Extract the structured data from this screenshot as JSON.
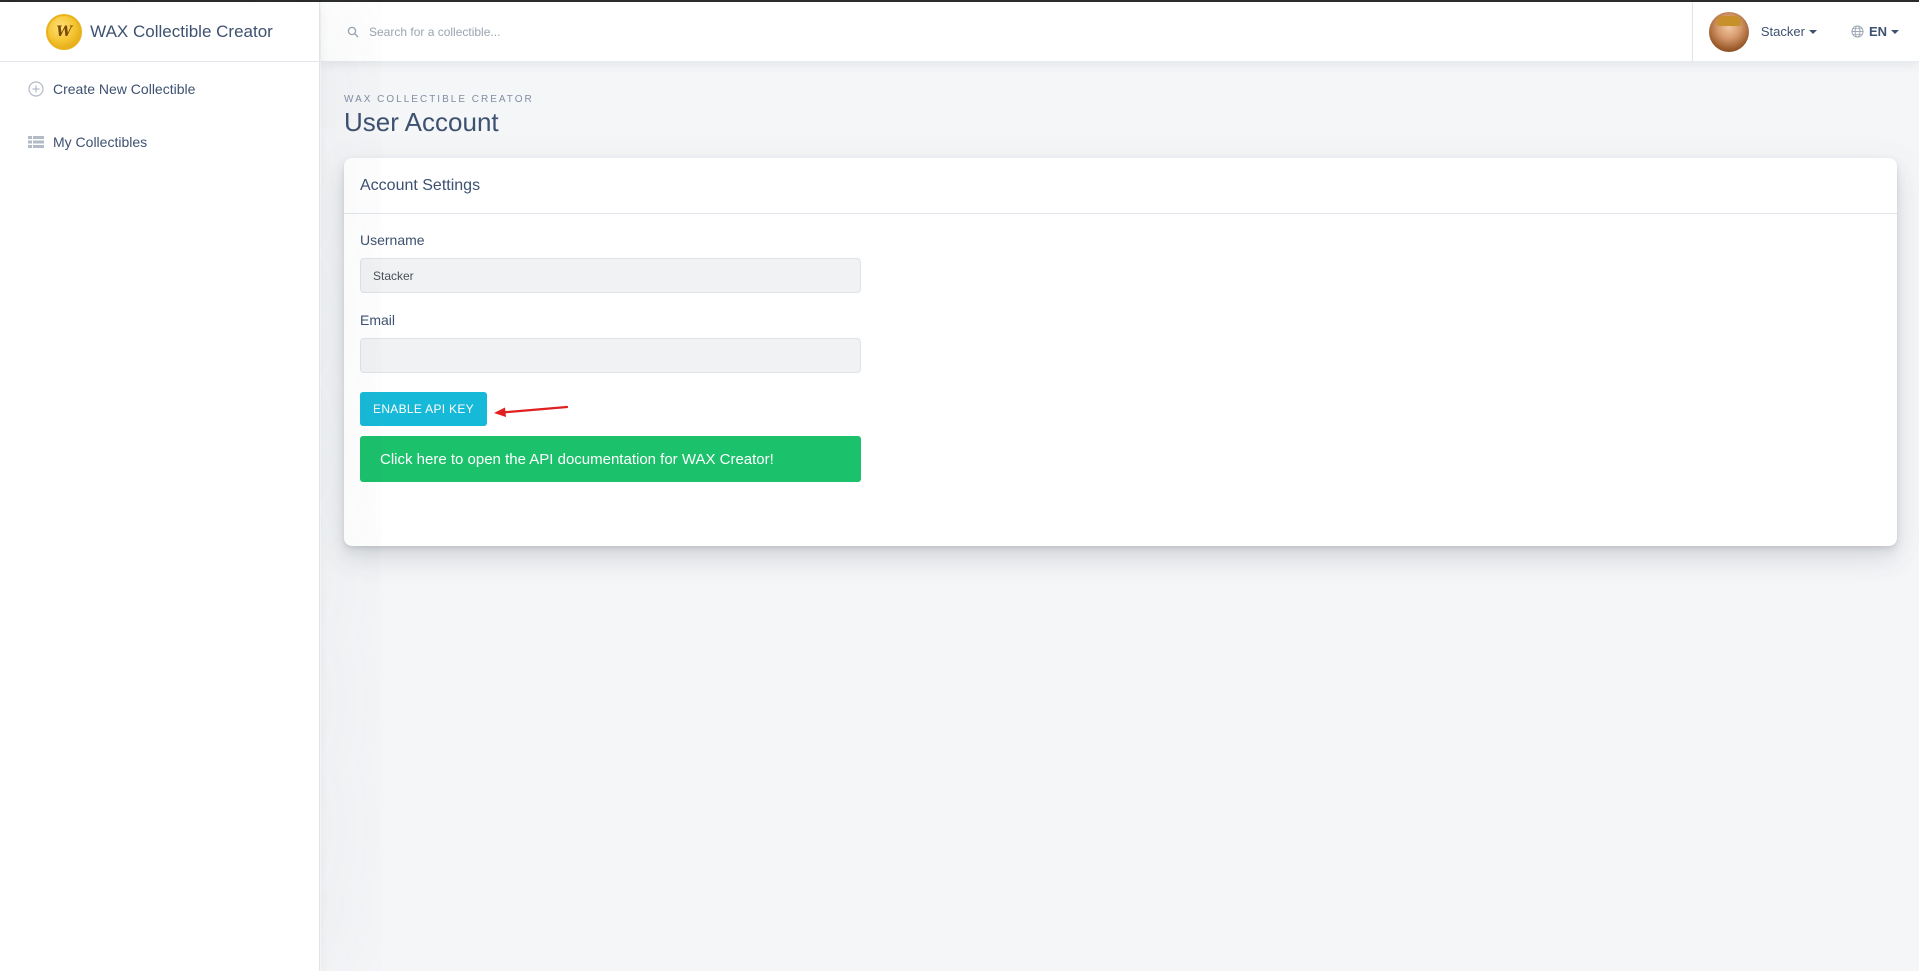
{
  "brand": {
    "title": "WAX Collectible Creator",
    "logo_letter": "W",
    "logo_color": "#f4c430"
  },
  "sidebar": {
    "items": [
      {
        "label": "Create New Collectible",
        "icon": "plus-circle-icon"
      },
      {
        "label": "My Collectibles",
        "icon": "list-icon"
      }
    ]
  },
  "header": {
    "search_placeholder": "Search for a collectible...",
    "user_name": "Stacker",
    "language": "EN"
  },
  "page": {
    "subtitle": "WAX COLLECTIBLE CREATOR",
    "title": "User Account"
  },
  "card": {
    "title": "Account Settings",
    "username_label": "Username",
    "username_value": "Stacker",
    "email_label": "Email",
    "email_value": "",
    "enable_api_label": "ENABLE API KEY",
    "docs_label": "Click here to open the API documentation for WAX Creator!"
  },
  "colors": {
    "accent_info": "#17b9d8",
    "accent_success": "#1bc16b",
    "annotation_arrow": "#e02020",
    "text_primary": "#3d5170"
  }
}
